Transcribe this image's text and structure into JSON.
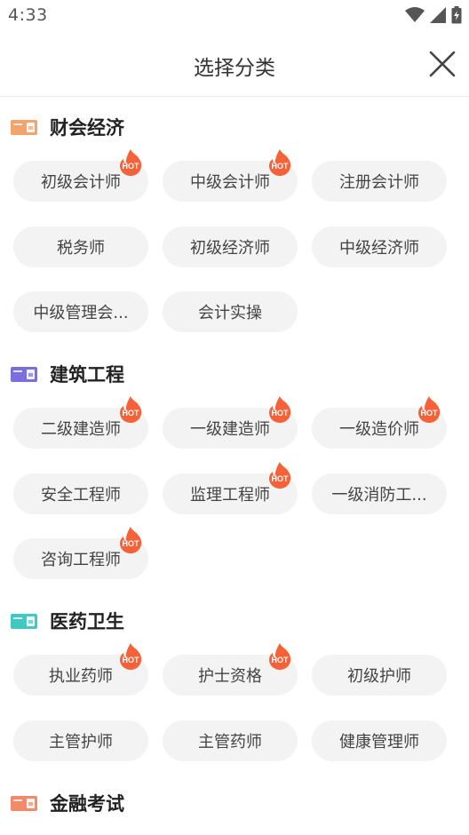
{
  "status_bar": {
    "time": "4:33"
  },
  "header": {
    "title": "选择分类"
  },
  "sections": [
    {
      "title": "财会经济",
      "icon": "accounting-ticket-icon",
      "icon_color": "#f4a46b",
      "items": [
        {
          "label": "初级会计师",
          "hot": true
        },
        {
          "label": "中级会计师",
          "hot": true
        },
        {
          "label": "注册会计师",
          "hot": false
        },
        {
          "label": "税务师",
          "hot": false
        },
        {
          "label": "初级经济师",
          "hot": false
        },
        {
          "label": "中级经济师",
          "hot": false
        },
        {
          "label": "中级管理会...",
          "hot": false
        },
        {
          "label": "会计实操",
          "hot": false
        }
      ]
    },
    {
      "title": "建筑工程",
      "icon": "construction-ticket-icon",
      "icon_color": "#7b6fe0",
      "items": [
        {
          "label": "二级建造师",
          "hot": true
        },
        {
          "label": "一级建造师",
          "hot": true
        },
        {
          "label": "一级造价师",
          "hot": true
        },
        {
          "label": "安全工程师",
          "hot": false
        },
        {
          "label": "监理工程师",
          "hot": true
        },
        {
          "label": "一级消防工...",
          "hot": false
        },
        {
          "label": "咨询工程师",
          "hot": true
        }
      ]
    },
    {
      "title": "医药卫生",
      "icon": "medicine-ticket-icon",
      "icon_color": "#3fc9c0",
      "items": [
        {
          "label": "执业药师",
          "hot": true
        },
        {
          "label": "护士资格",
          "hot": true
        },
        {
          "label": "初级护师",
          "hot": false
        },
        {
          "label": "主管护师",
          "hot": false
        },
        {
          "label": "主管药师",
          "hot": false
        },
        {
          "label": "健康管理师",
          "hot": false
        }
      ]
    },
    {
      "title": "金融考试",
      "icon": "finance-ticket-icon",
      "icon_color": "#f28a6a",
      "items": []
    }
  ],
  "hot_badge": {
    "label": "HOT",
    "color": "#f5623a"
  }
}
